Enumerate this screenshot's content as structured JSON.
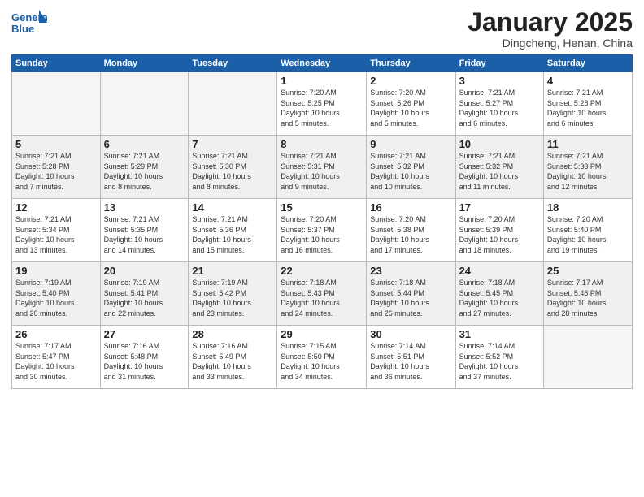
{
  "header": {
    "logo_line1": "General",
    "logo_line2": "Blue",
    "month": "January 2025",
    "location": "Dingcheng, Henan, China"
  },
  "weekdays": [
    "Sunday",
    "Monday",
    "Tuesday",
    "Wednesday",
    "Thursday",
    "Friday",
    "Saturday"
  ],
  "weeks": [
    [
      {
        "day": "",
        "info": ""
      },
      {
        "day": "",
        "info": ""
      },
      {
        "day": "",
        "info": ""
      },
      {
        "day": "1",
        "info": "Sunrise: 7:20 AM\nSunset: 5:25 PM\nDaylight: 10 hours\nand 5 minutes."
      },
      {
        "day": "2",
        "info": "Sunrise: 7:20 AM\nSunset: 5:26 PM\nDaylight: 10 hours\nand 5 minutes."
      },
      {
        "day": "3",
        "info": "Sunrise: 7:21 AM\nSunset: 5:27 PM\nDaylight: 10 hours\nand 6 minutes."
      },
      {
        "day": "4",
        "info": "Sunrise: 7:21 AM\nSunset: 5:28 PM\nDaylight: 10 hours\nand 6 minutes."
      }
    ],
    [
      {
        "day": "5",
        "info": "Sunrise: 7:21 AM\nSunset: 5:28 PM\nDaylight: 10 hours\nand 7 minutes."
      },
      {
        "day": "6",
        "info": "Sunrise: 7:21 AM\nSunset: 5:29 PM\nDaylight: 10 hours\nand 8 minutes."
      },
      {
        "day": "7",
        "info": "Sunrise: 7:21 AM\nSunset: 5:30 PM\nDaylight: 10 hours\nand 8 minutes."
      },
      {
        "day": "8",
        "info": "Sunrise: 7:21 AM\nSunset: 5:31 PM\nDaylight: 10 hours\nand 9 minutes."
      },
      {
        "day": "9",
        "info": "Sunrise: 7:21 AM\nSunset: 5:32 PM\nDaylight: 10 hours\nand 10 minutes."
      },
      {
        "day": "10",
        "info": "Sunrise: 7:21 AM\nSunset: 5:32 PM\nDaylight: 10 hours\nand 11 minutes."
      },
      {
        "day": "11",
        "info": "Sunrise: 7:21 AM\nSunset: 5:33 PM\nDaylight: 10 hours\nand 12 minutes."
      }
    ],
    [
      {
        "day": "12",
        "info": "Sunrise: 7:21 AM\nSunset: 5:34 PM\nDaylight: 10 hours\nand 13 minutes."
      },
      {
        "day": "13",
        "info": "Sunrise: 7:21 AM\nSunset: 5:35 PM\nDaylight: 10 hours\nand 14 minutes."
      },
      {
        "day": "14",
        "info": "Sunrise: 7:21 AM\nSunset: 5:36 PM\nDaylight: 10 hours\nand 15 minutes."
      },
      {
        "day": "15",
        "info": "Sunrise: 7:20 AM\nSunset: 5:37 PM\nDaylight: 10 hours\nand 16 minutes."
      },
      {
        "day": "16",
        "info": "Sunrise: 7:20 AM\nSunset: 5:38 PM\nDaylight: 10 hours\nand 17 minutes."
      },
      {
        "day": "17",
        "info": "Sunrise: 7:20 AM\nSunset: 5:39 PM\nDaylight: 10 hours\nand 18 minutes."
      },
      {
        "day": "18",
        "info": "Sunrise: 7:20 AM\nSunset: 5:40 PM\nDaylight: 10 hours\nand 19 minutes."
      }
    ],
    [
      {
        "day": "19",
        "info": "Sunrise: 7:19 AM\nSunset: 5:40 PM\nDaylight: 10 hours\nand 20 minutes."
      },
      {
        "day": "20",
        "info": "Sunrise: 7:19 AM\nSunset: 5:41 PM\nDaylight: 10 hours\nand 22 minutes."
      },
      {
        "day": "21",
        "info": "Sunrise: 7:19 AM\nSunset: 5:42 PM\nDaylight: 10 hours\nand 23 minutes."
      },
      {
        "day": "22",
        "info": "Sunrise: 7:18 AM\nSunset: 5:43 PM\nDaylight: 10 hours\nand 24 minutes."
      },
      {
        "day": "23",
        "info": "Sunrise: 7:18 AM\nSunset: 5:44 PM\nDaylight: 10 hours\nand 26 minutes."
      },
      {
        "day": "24",
        "info": "Sunrise: 7:18 AM\nSunset: 5:45 PM\nDaylight: 10 hours\nand 27 minutes."
      },
      {
        "day": "25",
        "info": "Sunrise: 7:17 AM\nSunset: 5:46 PM\nDaylight: 10 hours\nand 28 minutes."
      }
    ],
    [
      {
        "day": "26",
        "info": "Sunrise: 7:17 AM\nSunset: 5:47 PM\nDaylight: 10 hours\nand 30 minutes."
      },
      {
        "day": "27",
        "info": "Sunrise: 7:16 AM\nSunset: 5:48 PM\nDaylight: 10 hours\nand 31 minutes."
      },
      {
        "day": "28",
        "info": "Sunrise: 7:16 AM\nSunset: 5:49 PM\nDaylight: 10 hours\nand 33 minutes."
      },
      {
        "day": "29",
        "info": "Sunrise: 7:15 AM\nSunset: 5:50 PM\nDaylight: 10 hours\nand 34 minutes."
      },
      {
        "day": "30",
        "info": "Sunrise: 7:14 AM\nSunset: 5:51 PM\nDaylight: 10 hours\nand 36 minutes."
      },
      {
        "day": "31",
        "info": "Sunrise: 7:14 AM\nSunset: 5:52 PM\nDaylight: 10 hours\nand 37 minutes."
      },
      {
        "day": "",
        "info": ""
      }
    ]
  ]
}
